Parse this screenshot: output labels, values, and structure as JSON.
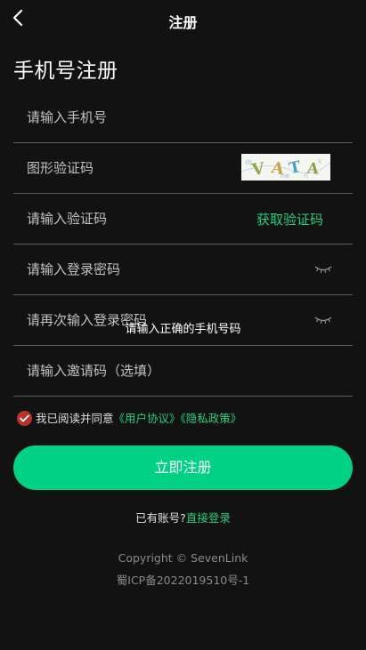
{
  "nav": {
    "title": "注册",
    "back_icon": "chevron-left-icon"
  },
  "page_title": "手机号注册",
  "fields": {
    "phone": {
      "placeholder": "请输入手机号",
      "value": ""
    },
    "captcha": {
      "placeholder": "图形验证码",
      "value": ""
    },
    "sms_code": {
      "placeholder": "请输入验证码",
      "value": "",
      "action_label": "获取验证码"
    },
    "password": {
      "placeholder": "请输入登录密码",
      "value": ""
    },
    "password_confirm": {
      "placeholder": "请再次输入登录密码",
      "value": ""
    },
    "invite_code": {
      "placeholder": "请输入邀请码（选填）",
      "value": ""
    }
  },
  "captcha_image_text": "VATA",
  "toast": "请输入正确的手机号码",
  "agreement": {
    "checked": true,
    "prefix": "我已阅读并同意",
    "user_agreement": "《用户协议》",
    "privacy_policy": "《隐私政策》"
  },
  "submit_label": "立即注册",
  "login": {
    "prompt": "已有账号?",
    "link": "直接登录"
  },
  "footer": {
    "copyright": "Copyright © SevenLink",
    "icp": "蜀ICP备2022019510号-1"
  },
  "colors": {
    "background": "#121212",
    "accent_green": "#00d184",
    "link_green": "#22cf7f",
    "check_red": "#b8332b",
    "divider": "#5a5a5a"
  }
}
